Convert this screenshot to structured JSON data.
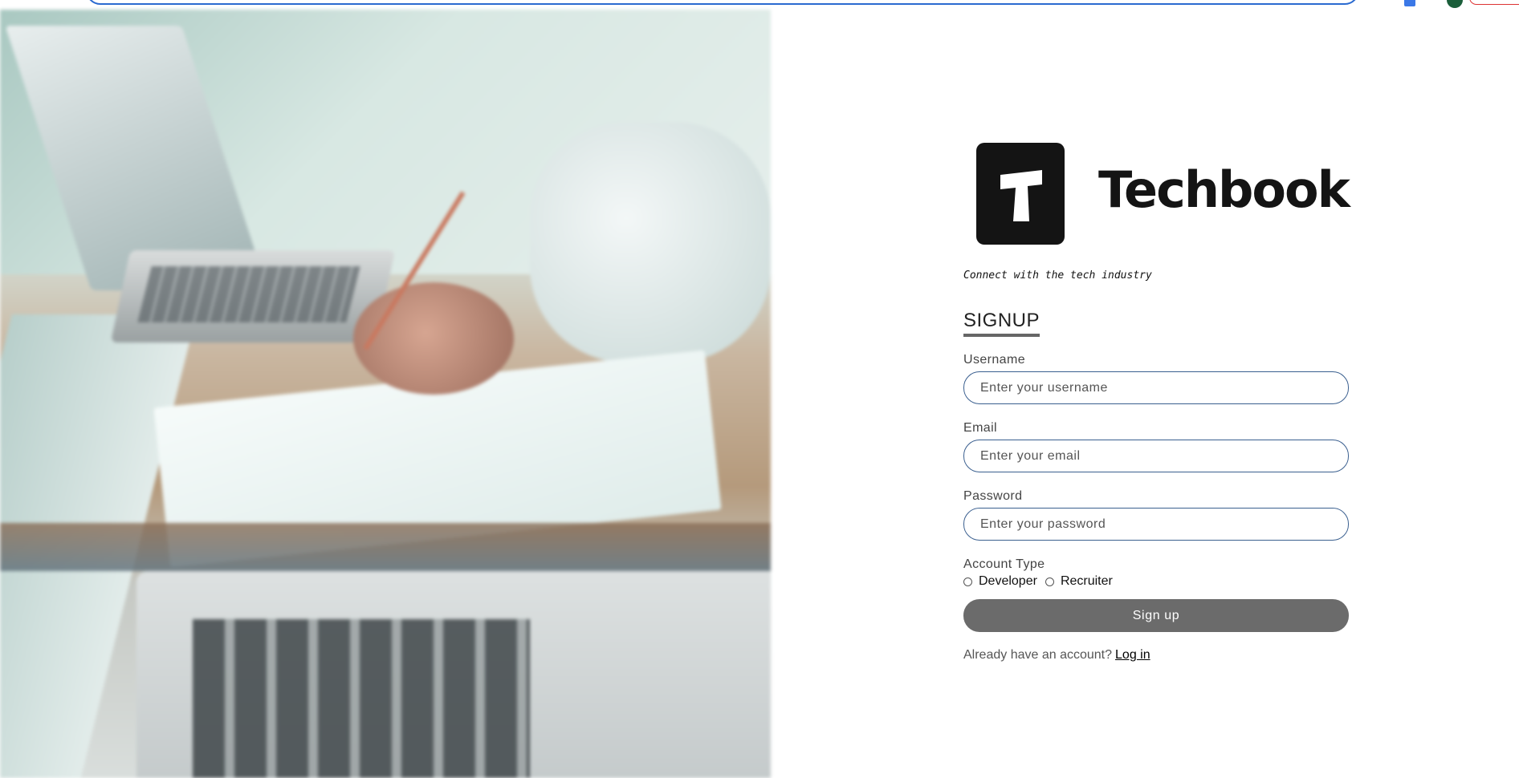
{
  "brand": {
    "logo_letter": "T",
    "name": "Techbook",
    "tagline": "Connect with the tech industry"
  },
  "form": {
    "heading": "SIGNUP",
    "username": {
      "label": "Username",
      "placeholder": "Enter your username",
      "value": ""
    },
    "email": {
      "label": "Email",
      "placeholder": "Enter your email",
      "value": ""
    },
    "password": {
      "label": "Password",
      "placeholder": "Enter your password",
      "value": ""
    },
    "account_type": {
      "label": "Account Type",
      "options": [
        "Developer",
        "Recruiter"
      ],
      "selected": null
    },
    "submit_label": "Sign up",
    "login_prompt": "Already have an account?",
    "login_link": "Log in"
  },
  "colors": {
    "button_bg": "#6b6b6b",
    "input_border": "#3a5f8f",
    "logo_bg": "#141414",
    "url_bar_focus": "#2a6ad0"
  }
}
